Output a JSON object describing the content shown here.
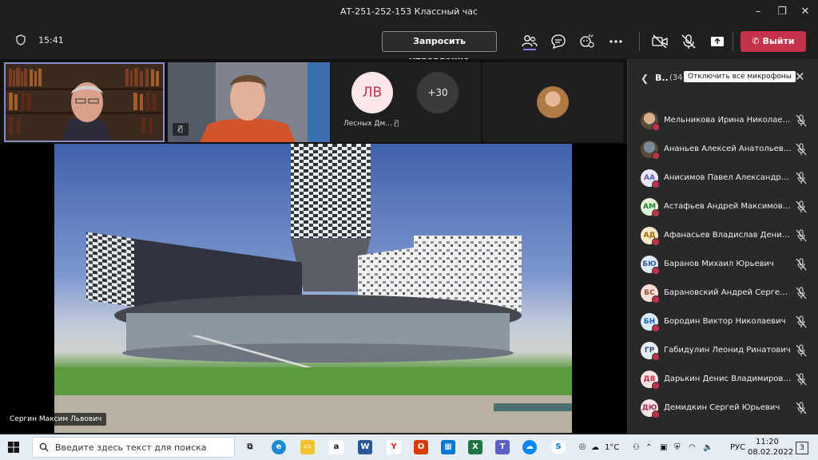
{
  "window": {
    "title": "АТ-251-252-153 Классный час",
    "minimize": "–",
    "maximize": "❐",
    "close": "✕"
  },
  "toolbar": {
    "time": "15:41",
    "request_control": "Запросить управление",
    "leave": "Выйти"
  },
  "gallery": {
    "tile3_initials": "ЛВ",
    "tile3_name": "Лесных Дм...",
    "more_count": "+30"
  },
  "stage": {
    "presenter_name": "Сергин Максим Львович"
  },
  "panel": {
    "title": "В..",
    "count": "(34)",
    "mute_all": "Отключить все микрофоны",
    "participants": [
      {
        "name": "Мельникова Ирина Николаевна",
        "initials": "",
        "bg": "#d9b08c",
        "fg": "#5a3b25",
        "photo": true
      },
      {
        "name": "Ананьев Алексей Анатольевич",
        "initials": "",
        "bg": "#7a8a9a",
        "fg": "#fff",
        "photo": true
      },
      {
        "name": "Анисимов Павел Александров...",
        "initials": "АА",
        "bg": "#e8e6fb",
        "fg": "#5b5fc7"
      },
      {
        "name": "Астафьев Андрей Максимович",
        "initials": "АМ",
        "bg": "#e0f2d8",
        "fg": "#2e7d32"
      },
      {
        "name": "Афанасьев Владислав Денисов...",
        "initials": "АД",
        "bg": "#fde9c9",
        "fg": "#a56a00"
      },
      {
        "name": "Баранов Михаил Юрьевич",
        "initials": "БЮ",
        "bg": "#e3ecfa",
        "fg": "#2f5aa8"
      },
      {
        "name": "Барановский Андрей Сергеевич",
        "initials": "БС",
        "bg": "#f9e0d6",
        "fg": "#a14a2a"
      },
      {
        "name": "Бородин Виктор Николаевич",
        "initials": "БН",
        "bg": "#dbeefd",
        "fg": "#1565c0"
      },
      {
        "name": "Габидулин Леонид Ринатович",
        "initials": "ГР",
        "bg": "#e6eef5",
        "fg": "#355070"
      },
      {
        "name": "Дарькин Денис Владимирович",
        "initials": "ДВ",
        "bg": "#fde3e6",
        "fg": "#c4314b"
      },
      {
        "name": "Демидкин Сергей Юрьевич",
        "initials": "ДЮ",
        "bg": "#fbe3ea",
        "fg": "#a3324f"
      }
    ]
  },
  "taskbar": {
    "search_placeholder": "Введите здесь текст для поиска",
    "weather": "1°C",
    "lang": "РУС",
    "time": "11:20",
    "date": "08.02.2022",
    "notifications": "3"
  }
}
